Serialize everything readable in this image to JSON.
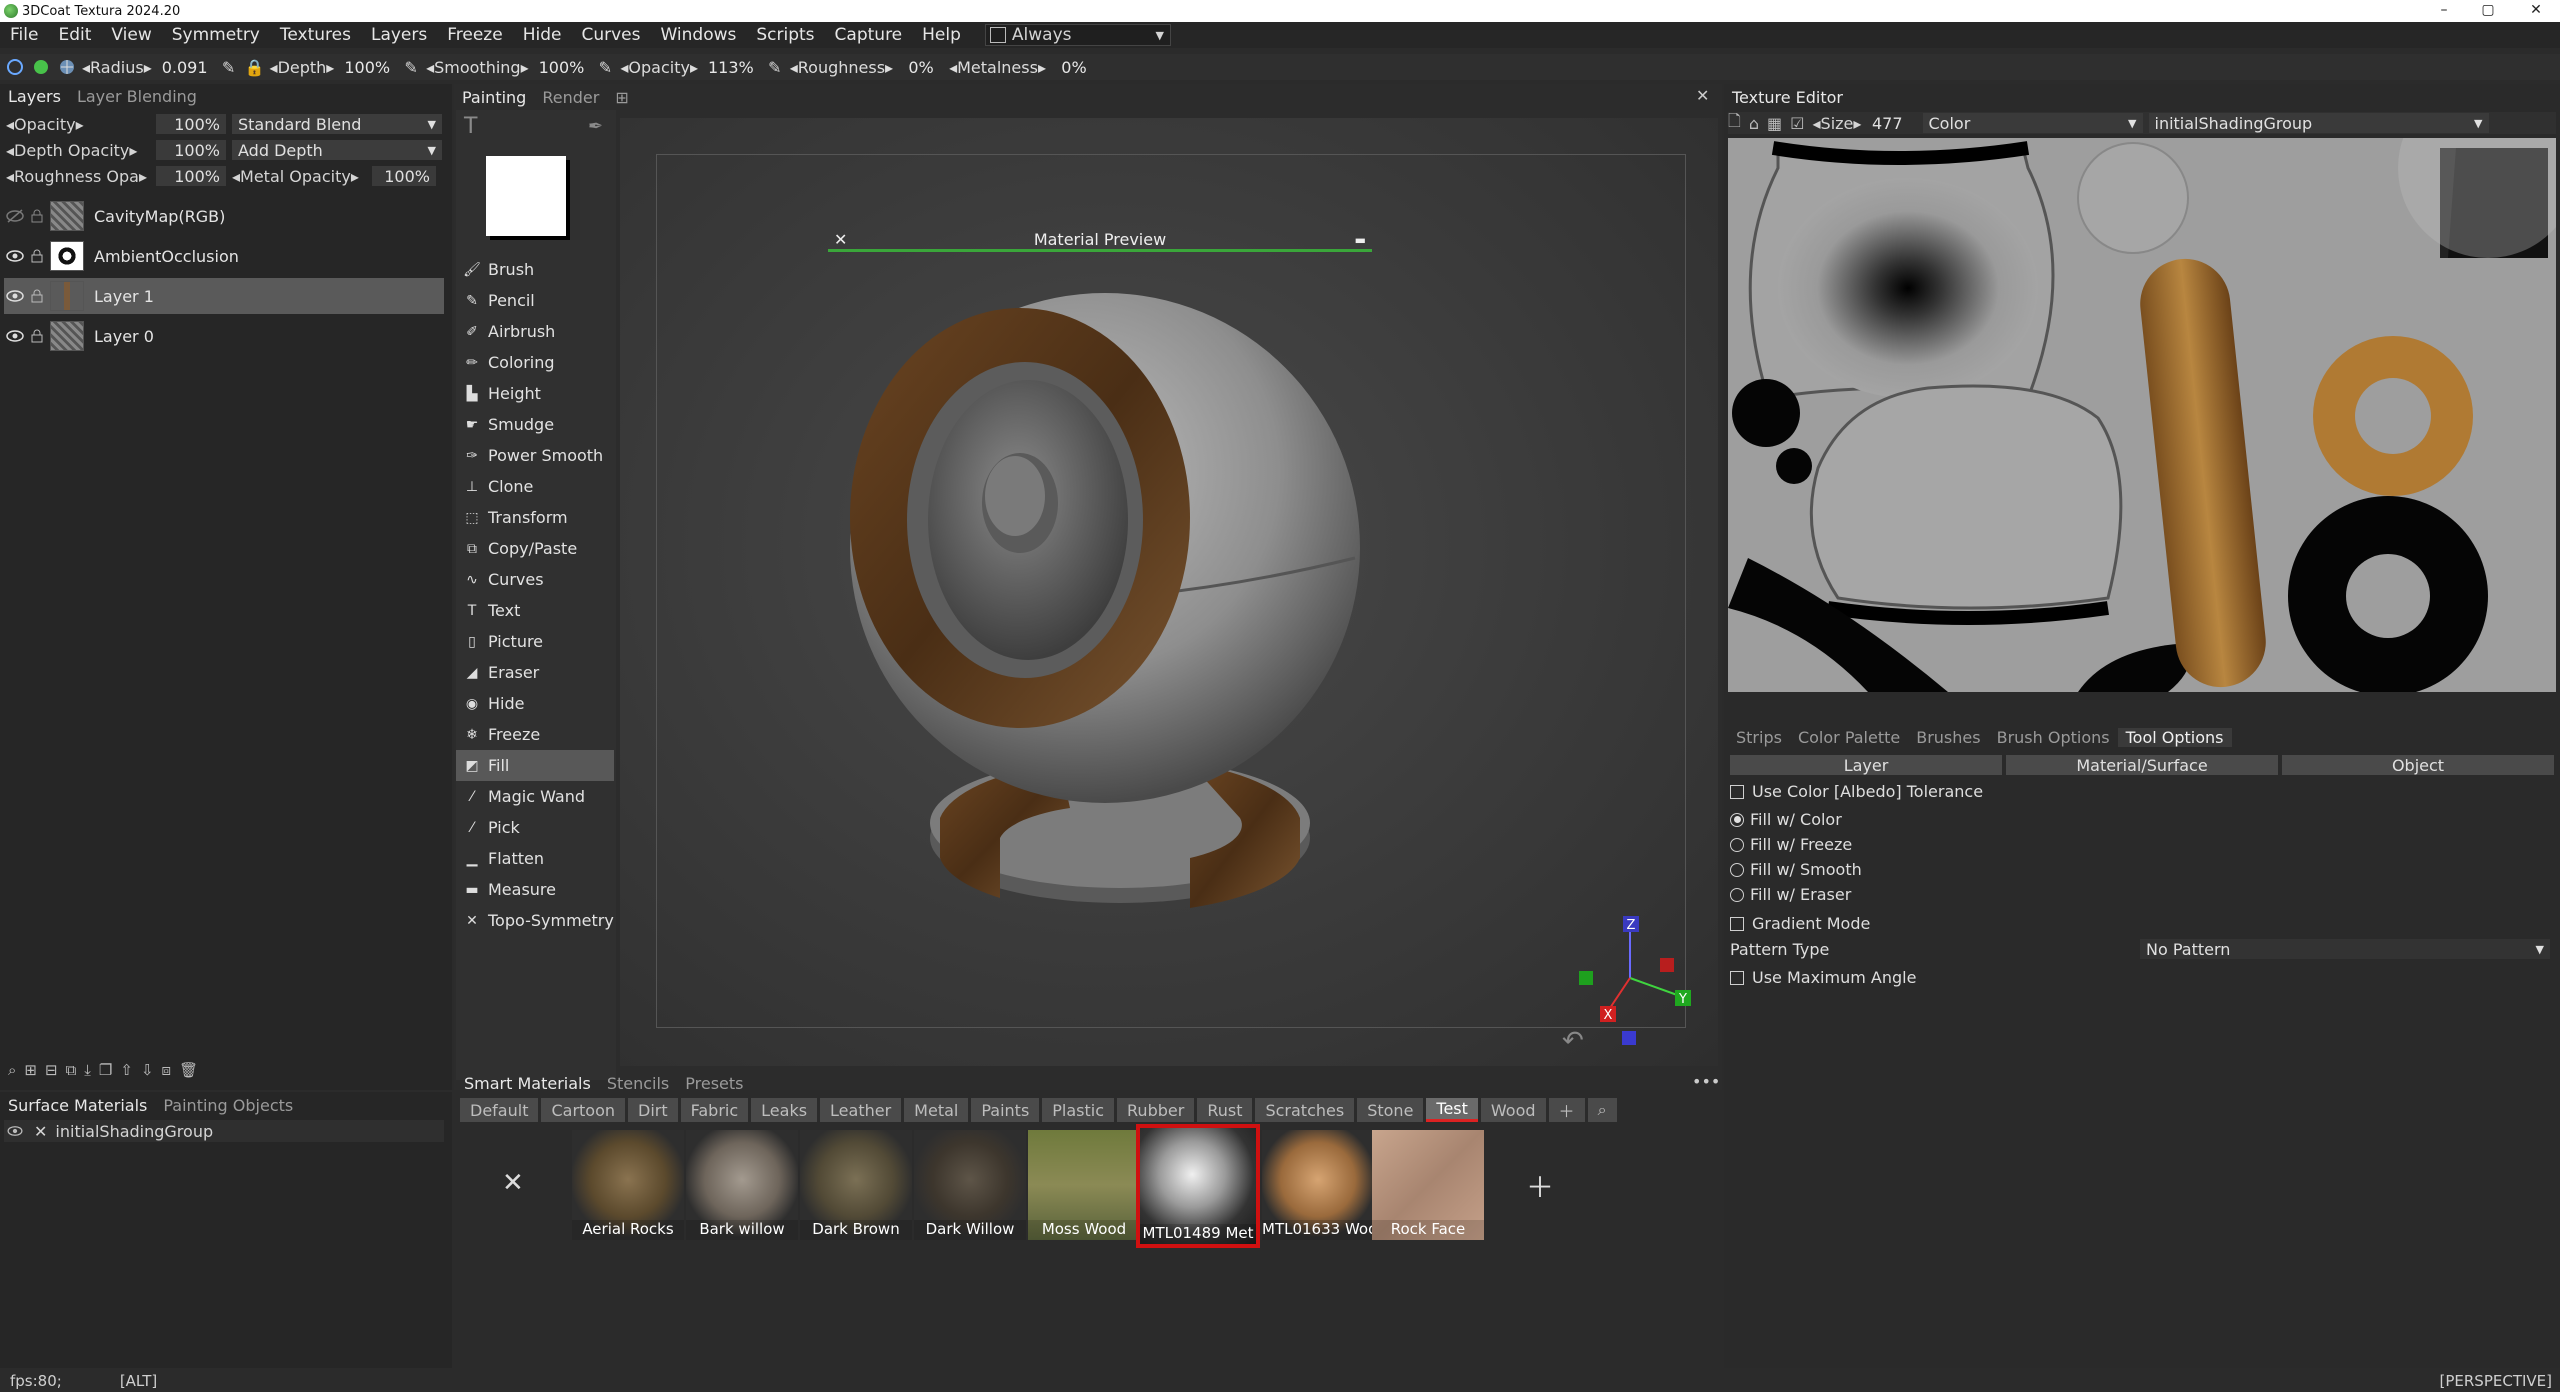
{
  "window": {
    "title": "3DCoat Textura 2024.20"
  },
  "menu": [
    "File",
    "Edit",
    "View",
    "Symmetry",
    "Textures",
    "Layers",
    "Freeze",
    "Hide",
    "Curves",
    "Windows",
    "Scripts",
    "Capture",
    "Help"
  ],
  "always_label": "Always",
  "toolbar": {
    "radius_label": "Radius",
    "radius_value": "0.091",
    "depth_label": "Depth",
    "depth_value": "100%",
    "smoothing_label": "Smoothing",
    "smoothing_value": "100%",
    "opacity_label": "Opacity",
    "opacity_value": "113%",
    "roughness_label": "Roughness",
    "roughness_value": "0%",
    "metalness_label": "Metalness",
    "metalness_value": "0%"
  },
  "layers_panel": {
    "tabs": [
      "Layers",
      "Layer Blending"
    ],
    "opacity_label": "Opacity",
    "opacity_value": "100%",
    "blend_mode": "Standard Blend",
    "depth_opacity_label": "Depth Opacity",
    "depth_opacity_value": "100%",
    "depth_mode": "Add Depth",
    "roughness_opa_label": "Roughness Opa",
    "roughness_opa_value": "100%",
    "metal_opacity_label": "Metal Opacity",
    "metal_opacity_value": "100%",
    "layers": [
      {
        "name": "CavityMap(RGB)"
      },
      {
        "name": "AmbientOcclusion"
      },
      {
        "name": "Layer 1"
      },
      {
        "name": "Layer 0"
      }
    ]
  },
  "bottom_left": {
    "tabs": [
      "Surface Materials",
      "Painting Objects"
    ],
    "item": "initialShadingGroup"
  },
  "center_tabs": [
    "Painting",
    "Render"
  ],
  "tools": [
    "Brush",
    "Pencil",
    "Airbrush",
    "Coloring",
    "Height",
    "Smudge",
    "Power Smooth",
    "Clone",
    "Transform",
    "Copy/Paste",
    "Curves",
    "Text",
    "Picture",
    "Eraser",
    "Hide",
    "Freeze",
    "Fill",
    "Magic Wand",
    "Pick",
    "Flatten",
    "Measure",
    "Topo-Symmetry"
  ],
  "active_tool": "Fill",
  "material_preview": {
    "title": "Material Preview"
  },
  "materials": {
    "section_tabs": [
      "Smart Materials",
      "Stencils",
      "Presets"
    ],
    "category_tabs": [
      "Default",
      "Cartoon",
      "Dirt",
      "Fabric",
      "Leaks",
      "Leather",
      "Metal",
      "Paints",
      "Plastic",
      "Rubber",
      "Rust",
      "Scratches",
      "Stone",
      "Test",
      "Wood"
    ],
    "active_category": "Test",
    "items": [
      {
        "name": "Aerial Rocks"
      },
      {
        "name": "Bark willow"
      },
      {
        "name": "Dark Brown"
      },
      {
        "name": "Dark Willow"
      },
      {
        "name": "Moss Wood"
      },
      {
        "name": "MTL01489 Met"
      },
      {
        "name": "MTL01633 Woo"
      },
      {
        "name": "Rock Face"
      }
    ]
  },
  "texture_editor": {
    "title": "Texture Editor",
    "size_label": "Size",
    "size_value": "477",
    "channel": "Color",
    "shading_group": "initialShadingGroup"
  },
  "tool_options": {
    "tabs": [
      "Strips",
      "Color Palette",
      "Brushes",
      "Brush Options",
      "Tool Options"
    ],
    "sub_tabs": [
      "Layer",
      "Material/Surface",
      "Object"
    ],
    "use_color_tolerance": "Use Color [Albedo] Tolerance",
    "fill_options": [
      "Fill w/ Color",
      "Fill w/ Freeze",
      "Fill w/ Smooth",
      "Fill w/ Eraser"
    ],
    "gradient_mode": "Gradient Mode",
    "pattern_type_label": "Pattern Type",
    "pattern_type_value": "No Pattern",
    "use_max_angle": "Use Maximum Angle"
  },
  "status": {
    "fps": "fps:80;",
    "alt": "[ALT]",
    "view": "[PERSPECTIVE]"
  },
  "gizmo": {
    "z": "Z",
    "y": "Y",
    "x": "X"
  }
}
